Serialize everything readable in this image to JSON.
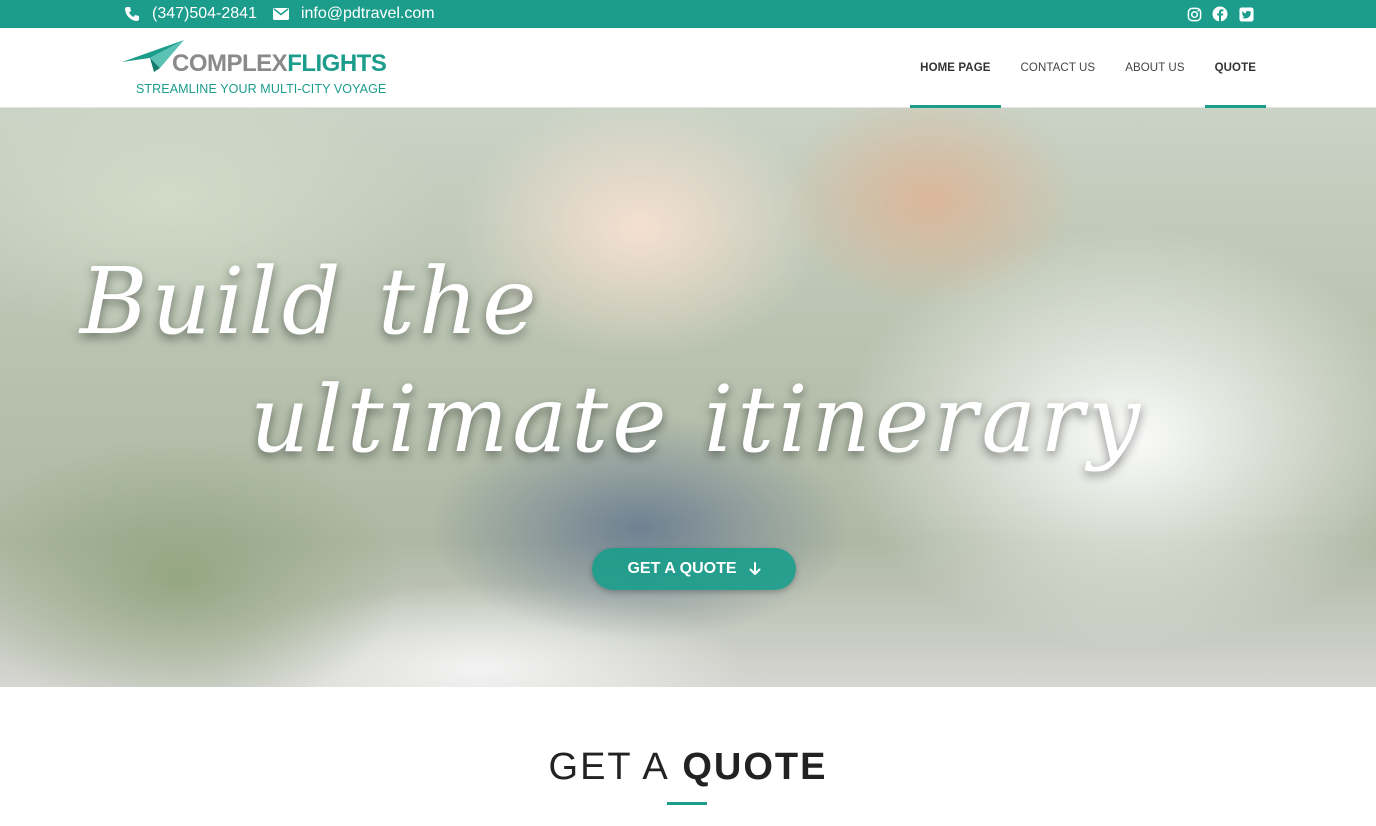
{
  "topbar": {
    "phone": "(347)504-2841",
    "email": "info@pdtravel.com",
    "social": [
      "instagram-icon",
      "facebook-icon",
      "twitter-icon"
    ]
  },
  "logo": {
    "brand_part1": "COMPLEX",
    "brand_part2": "FLIGHTS",
    "tagline": "STREAMLINE YOUR MULTI-CITY VOYAGE"
  },
  "nav": {
    "items": [
      {
        "label": "HOME PAGE"
      },
      {
        "label": "CONTACT US"
      },
      {
        "label": "ABOUT US"
      },
      {
        "label": "QUOTE"
      }
    ]
  },
  "hero": {
    "line1": "Build the",
    "line2": "ultimate itinerary",
    "cta_label": "GET A QUOTE"
  },
  "section": {
    "title_light": "GET A",
    "title_bold": "QUOTE"
  },
  "colors": {
    "accent": "#1c9d8c",
    "logo_gray": "#8a8a8a"
  }
}
